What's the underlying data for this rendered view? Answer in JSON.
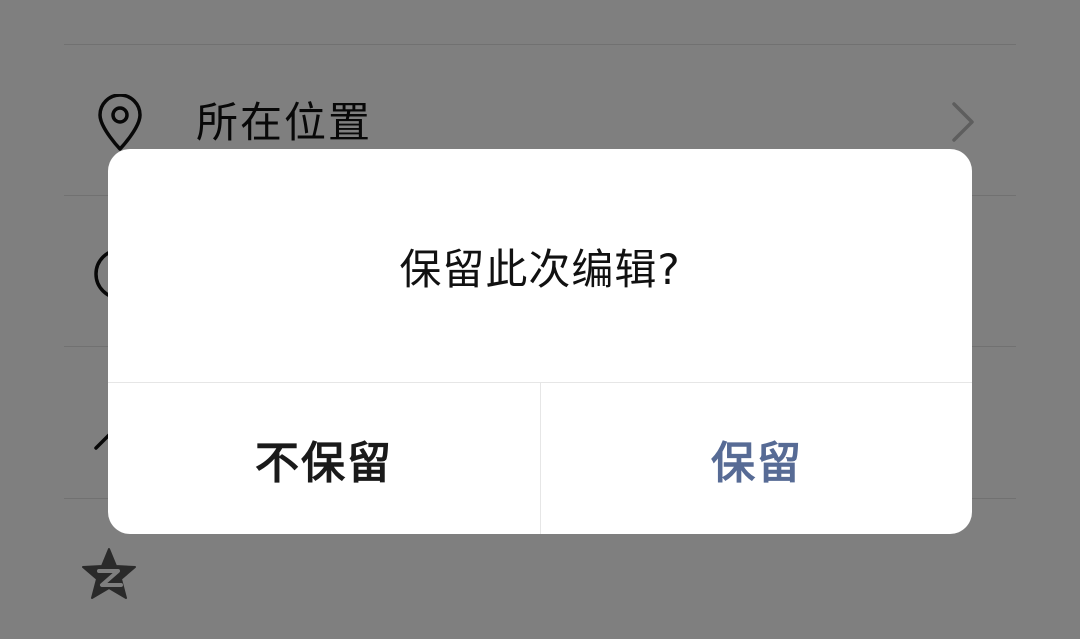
{
  "list": {
    "location_label": "所在位置"
  },
  "dialog": {
    "message": "保留此次编辑?",
    "discard_label": "不保留",
    "keep_label": "保留"
  },
  "colors": {
    "keep_accent": "#576b95",
    "overlay": "rgba(0,0,0,0.5)"
  },
  "icons": {
    "location": "location-pin-icon",
    "second_row": "circle-icon",
    "third_row": "arrow-icon",
    "qzone": "qzone-star-icon",
    "chevron": "chevron-right-icon"
  }
}
